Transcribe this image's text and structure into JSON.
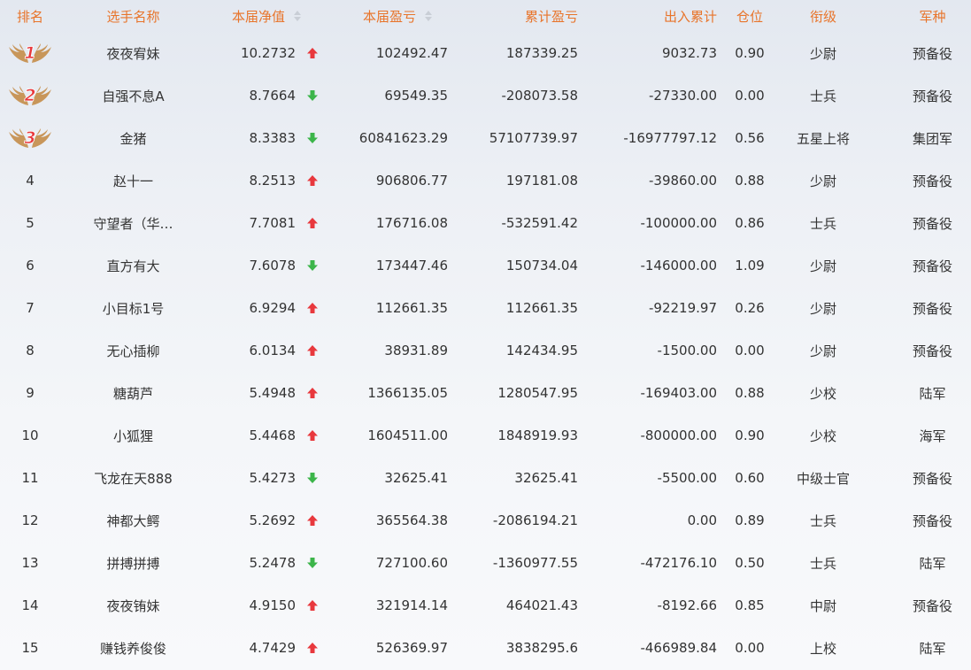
{
  "colors": {
    "header_text": "#e8742a",
    "up_arrow": "#e8383d",
    "down_arrow": "#3cb54a",
    "medal_number": "#e8383d",
    "wing": "#c8965a"
  },
  "header": {
    "rank": "排名",
    "name": "选手名称",
    "net_value": "本届净值",
    "profit": "本届盈亏",
    "cumulative": "累计盈亏",
    "in_out": "出入累计",
    "position": "仓位",
    "title": "衔级",
    "army": "军种"
  },
  "rows": [
    {
      "rank": "1",
      "medal": true,
      "name": "夜夜宥妹",
      "net": "10.2732",
      "trend": "up",
      "profit": "102492.47",
      "cumulative": "187339.25",
      "in_out": "9032.73",
      "position": "0.90",
      "title": "少尉",
      "army": "预备役"
    },
    {
      "rank": "2",
      "medal": true,
      "name": "自强不息A",
      "net": "8.7664",
      "trend": "down",
      "profit": "69549.35",
      "cumulative": "-208073.58",
      "in_out": "-27330.00",
      "position": "0.00",
      "title": "士兵",
      "army": "预备役"
    },
    {
      "rank": "3",
      "medal": true,
      "name": "金猪",
      "net": "8.3383",
      "trend": "down",
      "profit": "60841623.29",
      "cumulative": "57107739.97",
      "in_out": "-16977797.12",
      "position": "0.56",
      "title": "五星上将",
      "army": "集团军"
    },
    {
      "rank": "4",
      "medal": false,
      "name": "赵十一",
      "net": "8.2513",
      "trend": "up",
      "profit": "906806.77",
      "cumulative": "197181.08",
      "in_out": "-39860.00",
      "position": "0.88",
      "title": "少尉",
      "army": "预备役"
    },
    {
      "rank": "5",
      "medal": false,
      "name": "守望者（华…",
      "net": "7.7081",
      "trend": "up",
      "profit": "176716.08",
      "cumulative": "-532591.42",
      "in_out": "-100000.00",
      "position": "0.86",
      "title": "士兵",
      "army": "预备役"
    },
    {
      "rank": "6",
      "medal": false,
      "name": "直方有大",
      "net": "7.6078",
      "trend": "down",
      "profit": "173447.46",
      "cumulative": "150734.04",
      "in_out": "-146000.00",
      "position": "1.09",
      "title": "少尉",
      "army": "预备役"
    },
    {
      "rank": "7",
      "medal": false,
      "name": "小目标1号",
      "net": "6.9294",
      "trend": "up",
      "profit": "112661.35",
      "cumulative": "112661.35",
      "in_out": "-92219.97",
      "position": "0.26",
      "title": "少尉",
      "army": "预备役"
    },
    {
      "rank": "8",
      "medal": false,
      "name": "无心插柳",
      "net": "6.0134",
      "trend": "up",
      "profit": "38931.89",
      "cumulative": "142434.95",
      "in_out": "-1500.00",
      "position": "0.00",
      "title": "少尉",
      "army": "预备役"
    },
    {
      "rank": "9",
      "medal": false,
      "name": "糖葫芦",
      "net": "5.4948",
      "trend": "up",
      "profit": "1366135.05",
      "cumulative": "1280547.95",
      "in_out": "-169403.00",
      "position": "0.88",
      "title": "少校",
      "army": "陆军"
    },
    {
      "rank": "10",
      "medal": false,
      "name": "小狐狸",
      "net": "5.4468",
      "trend": "up",
      "profit": "1604511.00",
      "cumulative": "1848919.93",
      "in_out": "-800000.00",
      "position": "0.90",
      "title": "少校",
      "army": "海军"
    },
    {
      "rank": "11",
      "medal": false,
      "name": "飞龙在天888",
      "net": "5.4273",
      "trend": "down",
      "profit": "32625.41",
      "cumulative": "32625.41",
      "in_out": "-5500.00",
      "position": "0.60",
      "title": "中级士官",
      "army": "预备役"
    },
    {
      "rank": "12",
      "medal": false,
      "name": "神都大鳄",
      "net": "5.2692",
      "trend": "up",
      "profit": "365564.38",
      "cumulative": "-2086194.21",
      "in_out": "0.00",
      "position": "0.89",
      "title": "士兵",
      "army": "预备役"
    },
    {
      "rank": "13",
      "medal": false,
      "name": "拼搏拼搏",
      "net": "5.2478",
      "trend": "down",
      "profit": "727100.60",
      "cumulative": "-1360977.55",
      "in_out": "-472176.10",
      "position": "0.50",
      "title": "士兵",
      "army": "陆军"
    },
    {
      "rank": "14",
      "medal": false,
      "name": "夜夜铕妹",
      "net": "4.9150",
      "trend": "up",
      "profit": "321914.14",
      "cumulative": "464021.43",
      "in_out": "-8192.66",
      "position": "0.85",
      "title": "中尉",
      "army": "预备役"
    },
    {
      "rank": "15",
      "medal": false,
      "name": "赚钱养俊俊",
      "net": "4.7429",
      "trend": "up",
      "profit": "526369.97",
      "cumulative": "3838295.6",
      "in_out": "-466989.84",
      "position": "0.00",
      "title": "上校",
      "army": "陆军"
    }
  ]
}
